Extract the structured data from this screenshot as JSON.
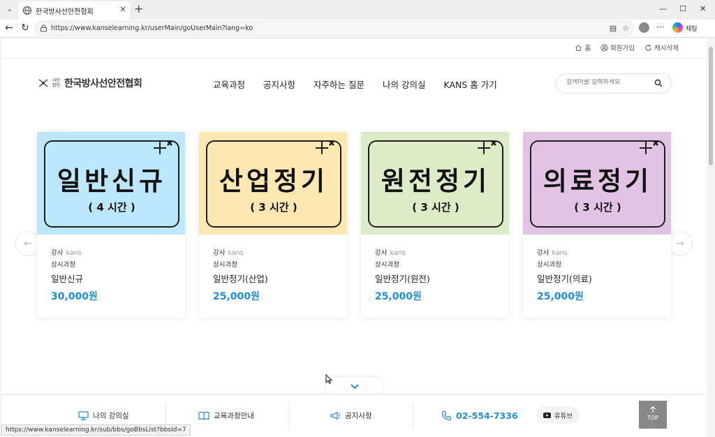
{
  "browser": {
    "tab_title": "한국방사선안전협회",
    "url": "https://www.kanselearning.kr/userMain/goUserMain?lang=ko",
    "copilot_label": "채팅",
    "status_url": "https://www.kanselearning.kr/sub/bbs/goBbsList?bbsId=7"
  },
  "util_links": [
    {
      "icon": "home-icon",
      "label": "홈"
    },
    {
      "icon": "user-icon",
      "label": "회원가입"
    },
    {
      "icon": "refresh-icon",
      "label": "캐시삭제"
    }
  ],
  "logo": {
    "small": "사단 법인",
    "name": "한국방사선안전협회"
  },
  "nav": [
    "교육과정",
    "공지사항",
    "자주하는 질문",
    "나의 강의실",
    "KANS 홈 가기"
  ],
  "search": {
    "placeholder": "검색어를 입력하세요"
  },
  "courses": [
    {
      "big": "일반신규",
      "hours": "( 4 시간 )",
      "bg": "#bde7fb",
      "instructor_label": "강사",
      "instructor": "kans",
      "category": "상시과정",
      "title": "일반신규",
      "price": "30,000원"
    },
    {
      "big": "산업정기",
      "hours": "( 3 시간 )",
      "bg": "#fde8b3",
      "instructor_label": "강사",
      "instructor": "kans",
      "category": "상시과정",
      "title": "일반정기(산업)",
      "price": "25,000원"
    },
    {
      "big": "원전정기",
      "hours": "( 3 시간 )",
      "bg": "#dcebc8",
      "instructor_label": "강사",
      "instructor": "kans",
      "category": "상시과정",
      "title": "일반정기(원전)",
      "price": "25,000원"
    },
    {
      "big": "의료정기",
      "hours": "( 3 시간 )",
      "bg": "#e2c3e4",
      "instructor_label": "강사",
      "instructor": "kans",
      "category": "상시과정",
      "title": "일반정기(의료)",
      "price": "25,000원"
    }
  ],
  "quick": {
    "classroom": "나의 강의실",
    "course_guide": "교육과정안내",
    "notice": "공지사항",
    "phone": "02-554-7336",
    "youtube": "유튜브",
    "top": "TOP"
  },
  "colors": {
    "accent": "#1f8fd1"
  }
}
